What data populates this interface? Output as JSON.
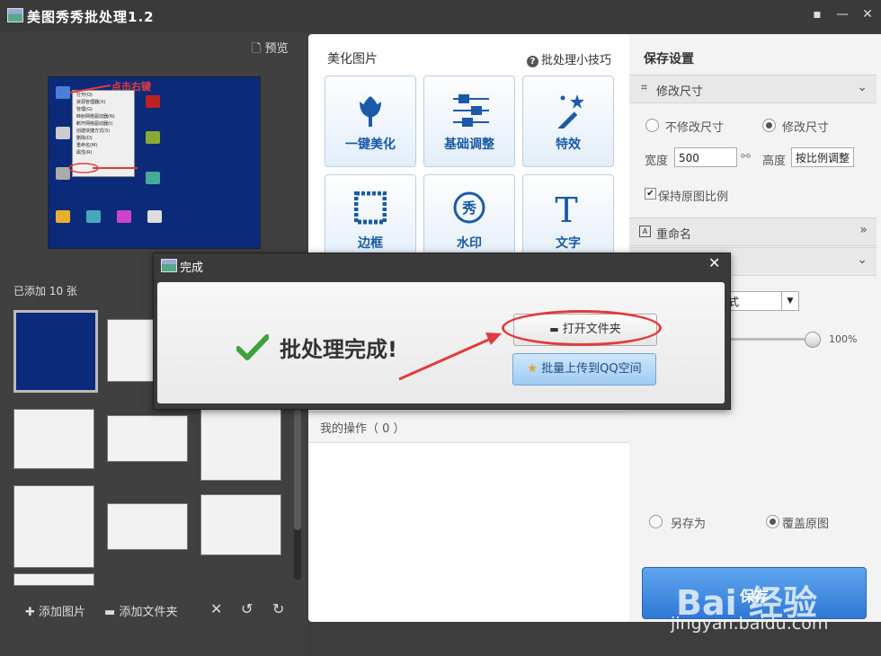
{
  "window": {
    "title": "美图秀秀批处理1.2",
    "controls": [
      "feedback-icon",
      "minimize-icon",
      "close-icon"
    ]
  },
  "left": {
    "preview_label": "预览",
    "preview_annotation": "点击右键",
    "context_menu_items": [
      "打开(O)",
      "资源管理器(X)",
      "管理(G)",
      "映射网络驱动器(N)",
      "断开网络驱动器(I)",
      "创建快捷方式(S)",
      "删除(D)",
      "重命名(M)",
      "属性(R)"
    ],
    "added_count": "已添加 10 张",
    "toolbar": {
      "add_image": "添加图片",
      "add_folder": "添加文件夹"
    }
  },
  "mid": {
    "title": "美化图片",
    "tips": "批处理小技巧",
    "tools": [
      "一键美化",
      "基础调整",
      "特效",
      "边框",
      "水印",
      "文字"
    ],
    "my_ops": "我的操作（ 0 ）"
  },
  "right": {
    "title": "保存设置",
    "resize_section": "修改尺寸",
    "no_resize": "不修改尺寸",
    "resize": "修改尺寸",
    "width_label": "宽度",
    "width_value": "500",
    "height_label": "高度",
    "height_value": "按比例调整",
    "keep_ratio": "保持原图比例",
    "rename_section": "重命名",
    "format_suffix": "式",
    "quality": "100%",
    "save_as": "另存为",
    "overwrite": "覆盖原图",
    "save_button": "保存"
  },
  "dialog": {
    "title": "完成",
    "message": "批处理完成!",
    "open_folder": "打开文件夹",
    "upload_qq": "批量上传到QQ空间"
  },
  "watermark": {
    "logo": "Bai 经验",
    "url": "jingyan.baidu.com"
  },
  "colors": {
    "accent_blue": "#2f78d6",
    "tool_text": "#1a5aa8",
    "check_green": "#3da13d",
    "annotation_red": "#e23b3b"
  }
}
